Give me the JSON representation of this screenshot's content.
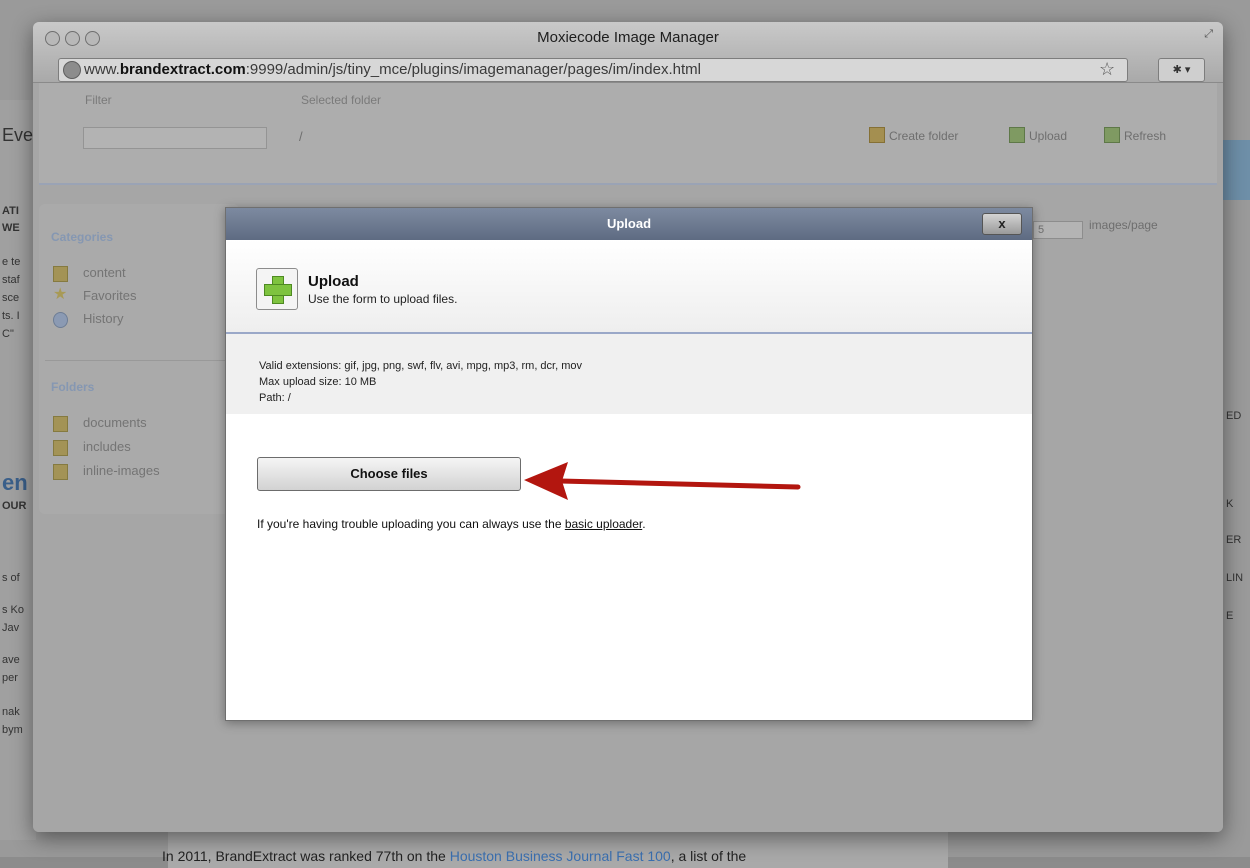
{
  "background_page": {
    "left_fragments": [
      "Eve",
      "ATI",
      "WE",
      "e te",
      "staf",
      "sce",
      "ts. I",
      "C\"",
      "en",
      "OUR",
      "s of",
      "s Ko",
      "Jav",
      "ave",
      "per",
      "nak",
      "bym"
    ],
    "right_fragments": [
      "ED",
      "K",
      "ER",
      "LIN",
      "E"
    ],
    "bottom_text_prefix": "In 2011, BrandExtract was ranked 77th on the ",
    "bottom_text_link": "Houston Business Journal Fast 100",
    "bottom_text_suffix": ", a list of the"
  },
  "browser": {
    "window_title": "Moxiecode Image Manager",
    "url_prefix": "www.",
    "url_domain": "brandextract.com",
    "url_rest": ":9999/admin/js/tiny_mce/plugins/imagemanager/pages/im/index.html"
  },
  "image_manager": {
    "filter_label": "Filter",
    "selected_folder_label": "Selected folder",
    "selected_folder_value": "/",
    "toolbar": {
      "create_folder": "Create folder",
      "upload": "Upload",
      "refresh": "Refresh"
    },
    "per_page_value": "5",
    "per_page_label": "images/page",
    "sidebar": {
      "categories_heading": "Categories",
      "categories": [
        "content",
        "Favorites",
        "History"
      ],
      "folders_heading": "Folders",
      "folders": [
        "documents",
        "includes",
        "inline-images"
      ]
    }
  },
  "upload_dialog": {
    "title": "Upload",
    "close_label": "x",
    "header_title": "Upload",
    "header_subtitle": "Use the form to upload files.",
    "valid_extensions": "Valid extensions: gif, jpg, png, swf, flv, avi, mpg, mp3, rm, dcr, mov",
    "max_upload": "Max upload size: 10 MB",
    "path": "Path: /",
    "choose_files_label": "Choose files",
    "trouble_text": "If you're having trouble uploading you can always use the ",
    "basic_uploader_link": "basic uploader",
    "trouble_suffix": "."
  },
  "colors": {
    "annotation_arrow": "#b3160f",
    "plus_icon": "#7ec33f",
    "dialog_titlebar": "#6b788f"
  }
}
